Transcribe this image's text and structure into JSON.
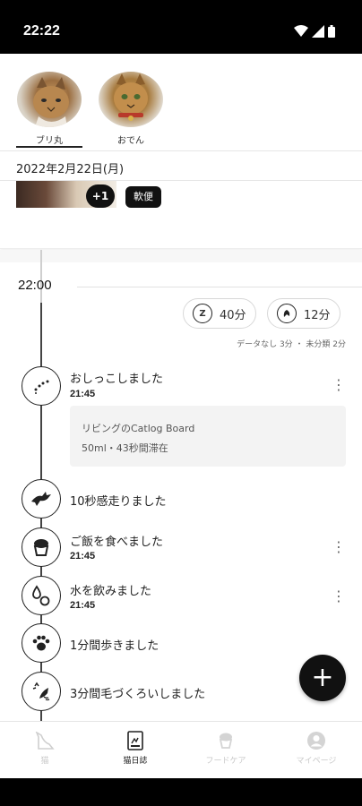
{
  "status_bar": {
    "time": "22:22"
  },
  "cats": [
    {
      "name": "ブリ丸",
      "selected": true
    },
    {
      "name": "おでん",
      "selected": false
    }
  ],
  "date_header": "2022年2月22日(月)",
  "previous_entry": {
    "more_badge": "+1",
    "tag": "軟便"
  },
  "time_section": {
    "time": "22:00"
  },
  "stats": [
    {
      "icon": "sleep-icon",
      "value": "40分"
    },
    {
      "icon": "rest-icon",
      "value": "12分"
    }
  ],
  "summary_text": "データなし 3分 ・ 未分類 2分",
  "events": [
    {
      "icon": "urine-icon",
      "title": "おしっこしました",
      "time": "21:45",
      "has_menu": true,
      "detail": {
        "line1": "リビングのCatlog Board",
        "line2": "50ml・43秒間滞在"
      }
    },
    {
      "icon": "running-cat-icon",
      "title": "10秒感走りました"
    },
    {
      "icon": "food-bowl-icon",
      "title": "ご飯を食べました",
      "time": "21:45",
      "has_menu": true
    },
    {
      "icon": "water-drop-icon",
      "title": "水を飲みました",
      "time": "21:45",
      "has_menu": true
    },
    {
      "icon": "paw-icon",
      "title": "1分間歩きました"
    },
    {
      "icon": "grooming-icon",
      "title": "3分間毛づくろいしました"
    }
  ],
  "fab": {
    "label": "+"
  },
  "bottom_nav": [
    {
      "label": "猫",
      "icon": "cat-icon",
      "active": false
    },
    {
      "label": "猫日誌",
      "icon": "diary-icon",
      "active": true
    },
    {
      "label": "フードケア",
      "icon": "food-care-icon",
      "active": false
    },
    {
      "label": "マイページ",
      "icon": "profile-icon",
      "active": false
    }
  ],
  "colors": {
    "accent": "#111111",
    "timeline": "#cfcfcf",
    "inactive": "#c9c9c9",
    "detail_bg": "#f3f3f3"
  }
}
